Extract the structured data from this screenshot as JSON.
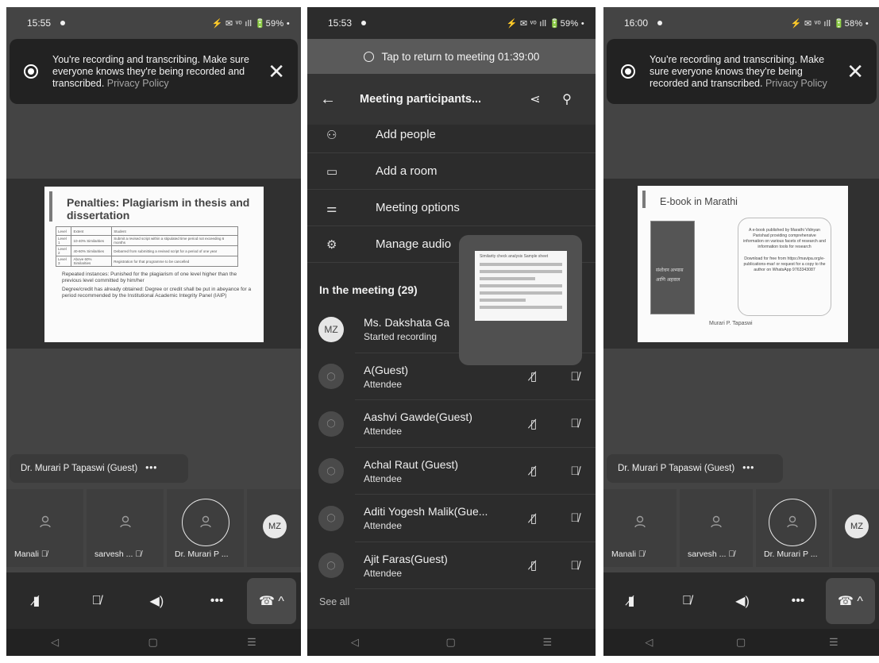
{
  "screen1": {
    "time": "15:55",
    "status_right": "⚡ ✉ ᵛᵒ ıll 🔋59% •",
    "banner": {
      "text": "You're recording and transcribing. Make sure everyone knows they're being recorded and transcribed.",
      "link": "Privacy Policy"
    },
    "slide": {
      "title": "Penalties: Plagiarism in thesis and dissertation",
      "table_header": [
        "Level",
        "Extent",
        "Student"
      ],
      "table_rows": [
        [
          "Level 1",
          "10-40% Similarities",
          "Submit a revised script within a stipulated time period not exceeding 6 months"
        ],
        [
          "Level 2",
          "40-60% Similarities",
          "Debarred from submitting a revised script for a period of one year"
        ],
        [
          "Level 3",
          "Above 60% Similarities",
          "Registration for that programme to be cancelled"
        ]
      ],
      "bullets": [
        "Repeated instances: Punished for the plagiarism of one level higher than the previous level committed by him/her",
        "Degree/credit has already obtained: Degree or credit shall be put in abeyance for a period recommended by the Institutional Academic Integrity Panel (IAIP)"
      ]
    },
    "presenter": "Dr. Murari P Tapaswi (Guest)",
    "more": "•••",
    "tiles": [
      "Manali",
      "sarvesh ...",
      "Dr. Murari P ...",
      "MZ"
    ]
  },
  "screen2": {
    "time": "15:53",
    "status_right": "⚡ ✉ ᵛᵒ ıll 🔋59% •",
    "tap_text": "Tap to return to meeting 01:39:00",
    "title": "Meeting participants...",
    "menu": [
      {
        "icon": "add-people-icon",
        "label": "Add people"
      },
      {
        "icon": "add-room-icon",
        "label": "Add a room"
      },
      {
        "icon": "meeting-options-icon",
        "label": "Meeting options"
      },
      {
        "icon": "settings-icon",
        "label": "Manage audio"
      }
    ],
    "section": "In the meeting (29)",
    "participants": [
      {
        "initials": "MZ",
        "name": "Ms. Dakshata Ga",
        "role": "Started recording"
      },
      {
        "name": "A(Guest)",
        "role": "Attendee"
      },
      {
        "name": "Aashvi Gawde(Guest)",
        "role": "Attendee"
      },
      {
        "name": "Achal Raut (Guest)",
        "role": "Attendee"
      },
      {
        "name": "Aditi Yogesh Malik(Gue...",
        "role": "Attendee"
      },
      {
        "name": "Ajit Faras(Guest)",
        "role": "Attendee"
      }
    ],
    "see_all": "See all",
    "pip_title": "Similarity check analysis Sample sheet"
  },
  "screen3": {
    "time": "16:00",
    "status_right": "⚡ ✉ ᵛᵒ ıll 🔋58% •",
    "banner": {
      "text": "You're recording and transcribing. Make sure everyone knows they're being recorded and transcribed.",
      "link": "Privacy Policy"
    },
    "slide": {
      "title": "E-book in Marathi",
      "book_text": "संशोधन अभ्यास आणि अहवाल",
      "info": "A e-book published by Marathi Vidnyan Parishad providing comprehensive information on various facets of research and information tools for research",
      "download": "Download for free from https://mavipa.org/e-publications-mar/ or request for a copy to the author on WhatsApp 9763343087",
      "author": "Murari P. Tapaswi"
    },
    "presenter": "Dr. Murari P Tapaswi (Guest)",
    "more": "•••",
    "tiles": [
      "Manali",
      "sarvesh ...",
      "Dr. Murari P ...",
      "MZ"
    ]
  },
  "nav": [
    "◁",
    "▢",
    "☰"
  ]
}
